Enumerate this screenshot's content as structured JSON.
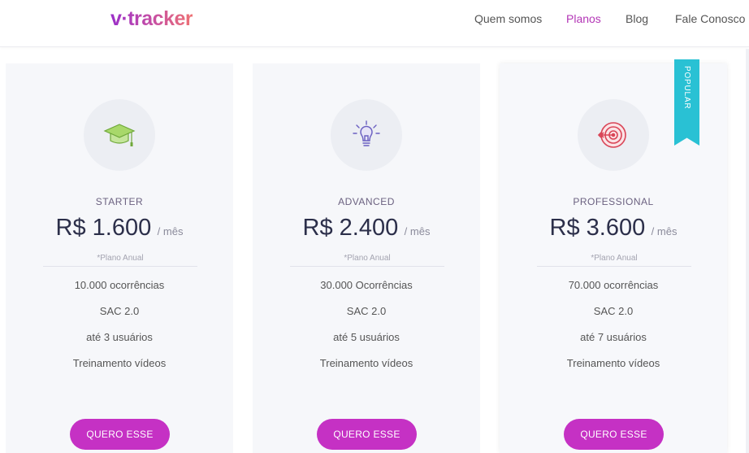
{
  "header": {
    "logo": "v·tracker",
    "nav": [
      {
        "label": "Quem somos"
      },
      {
        "label": "Planos",
        "active": true
      },
      {
        "label": "Blog"
      },
      {
        "label": "Fale Conosco"
      }
    ]
  },
  "colors": {
    "accent": "#c531c4",
    "ribbon": "#29c1d4",
    "price": "#2c2f4a",
    "card_bg": "#f6f7fa"
  },
  "plans": [
    {
      "icon": "graduation-cap-icon",
      "name": "STARTER",
      "price": "R$ 1.600",
      "per": "/ mês",
      "note": "*Plano Anual",
      "features": [
        "10.000 ocorrências",
        "SAC 2.0",
        "até 3 usuários",
        "Treinamento vídeos"
      ],
      "button": "QUERO ESSE"
    },
    {
      "icon": "lightbulb-icon",
      "name": "ADVANCED",
      "price": "R$ 2.400",
      "per": "/ mês",
      "note": "*Plano Anual",
      "features": [
        "30.000 Ocorrências",
        "SAC 2.0",
        "até 5 usuários",
        "Treinamento vídeos"
      ],
      "button": "QUERO ESSE"
    },
    {
      "icon": "target-icon",
      "name": "PROFESSIONAL",
      "price": "R$ 3.600",
      "per": "/ mês",
      "note": "*Plano Anual",
      "features": [
        "70.000 ocorrências",
        "SAC 2.0",
        "até 7 usuários",
        "Treinamento vídeos"
      ],
      "button": "QUERO ESSE",
      "badge": "POPULAR"
    }
  ]
}
